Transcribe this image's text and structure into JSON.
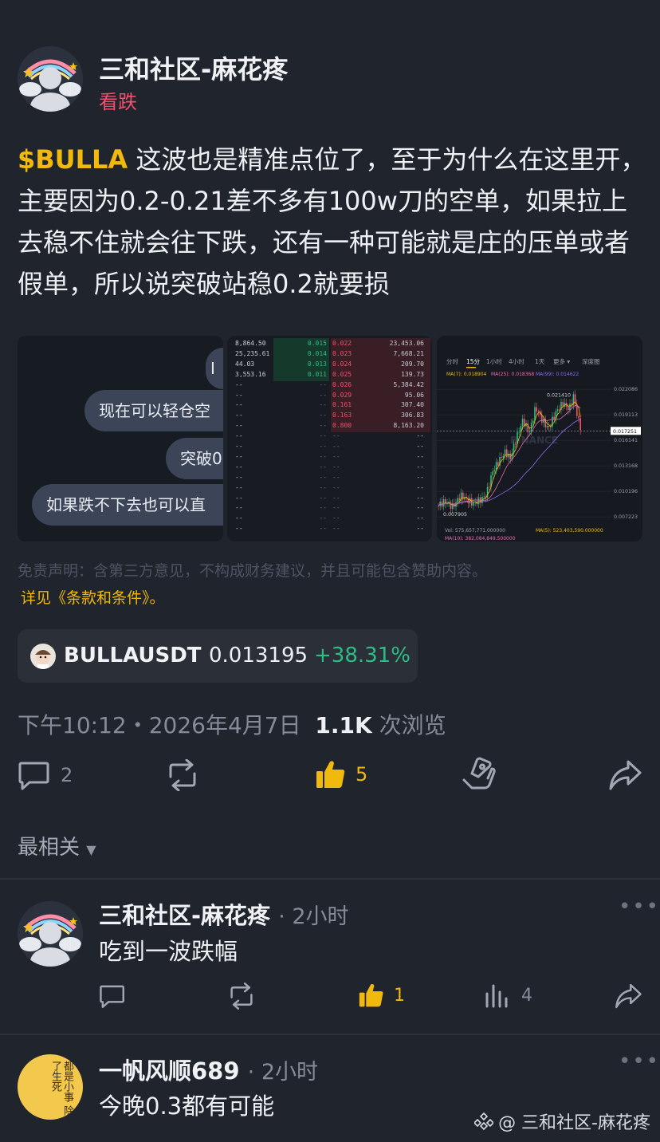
{
  "post": {
    "author": "三和社区-麻花疼",
    "sentiment_tag": "看跌",
    "ticker": "$BULLA",
    "body": " 这波也是精准点位了，至于为什么在这里开，主要因为0.2-0.21差不多有100w刀的空单，如果拉上去稳不住就会往下跌，还有一种可能就是庄的压单或者假单，所以说突破站稳0.2就要损",
    "disclaimer": "免责声明：含第三方意见，不构成财务建议，并且可能包含赞助内容。",
    "terms": "详见《条款和条件》。",
    "timestamp": "下午10:12・2026年4月7日",
    "views_count": "1.1K",
    "views_label": "次浏览"
  },
  "chat_image": {
    "bubbles": [
      "I",
      "现在可以轻仓空",
      "突破0",
      "如果跌不下去也可以直"
    ]
  },
  "orderbook_image": {
    "rows": [
      {
        "vol": "8,864.50",
        "bid": "0.015",
        "ask": "0.022",
        "askvol": "23,453.06"
      },
      {
        "vol": "25,235.61",
        "bid": "0.014",
        "ask": "0.023",
        "askvol": "7,668.21"
      },
      {
        "vol": "44.03",
        "bid": "0.013",
        "ask": "0.024",
        "askvol": "209.70"
      },
      {
        "vol": "3,553.16",
        "bid": "0.011",
        "ask": "0.025",
        "askvol": "139.73"
      },
      {
        "vol": "--",
        "bid": "--",
        "ask": "0.026",
        "askvol": "5,384.42"
      },
      {
        "vol": "--",
        "bid": "--",
        "ask": "0.029",
        "askvol": "95.06"
      },
      {
        "vol": "--",
        "bid": "--",
        "ask": "0.161",
        "askvol": "307.40"
      },
      {
        "vol": "--",
        "bid": "--",
        "ask": "0.163",
        "askvol": "306.83"
      },
      {
        "vol": "--",
        "bid": "--",
        "ask": "0.800",
        "askvol": "8,163.20"
      }
    ],
    "empty": "--"
  },
  "chart_image": {
    "tabs": [
      "分时",
      "15分",
      "1小时",
      "4小时",
      "1天",
      "更多 ▾",
      "深度图"
    ],
    "ma_line": [
      "MA(7): 0.018904",
      "MA(25): 0.018368",
      "MA(99): 0.014622"
    ],
    "price_labels": [
      "0.022086",
      "0.019113",
      "0.016141",
      "0.013168",
      "0.010196",
      "0.007223"
    ],
    "current_price": "0.017251",
    "high_label": "0.021410",
    "low_label": "0.007905",
    "vol_line": "Vol: 575,657,771.000000",
    "ma5_line": "MA(5): 523,403,590.000000",
    "ma10_line": "MA(10): 382,084,849.500000",
    "watermark": "BINANCE"
  },
  "coin": {
    "symbol": "BULLAUSDT",
    "price": "0.013195",
    "change": "+38.31%"
  },
  "actions": {
    "comments": "2",
    "likes": "5"
  },
  "sort_label": "最相关",
  "comments": [
    {
      "author": "三和社区-麻花疼",
      "time": "· 2小时",
      "text": "吃到一波跌幅",
      "likes": "1",
      "views": "4"
    },
    {
      "author": "一帆风顺689",
      "time": "· 2小时",
      "text": "今晚0.3都有可能",
      "avatar_text": "都是小事 除了生死"
    }
  ],
  "watermark": "@ 三和社区-麻花疼",
  "colors": {
    "background": "#1f242d",
    "accent_yellow": "#f0b90b",
    "bearish_red": "#f0506e",
    "bullish_green": "#2ebd85",
    "muted": "#858c99"
  }
}
